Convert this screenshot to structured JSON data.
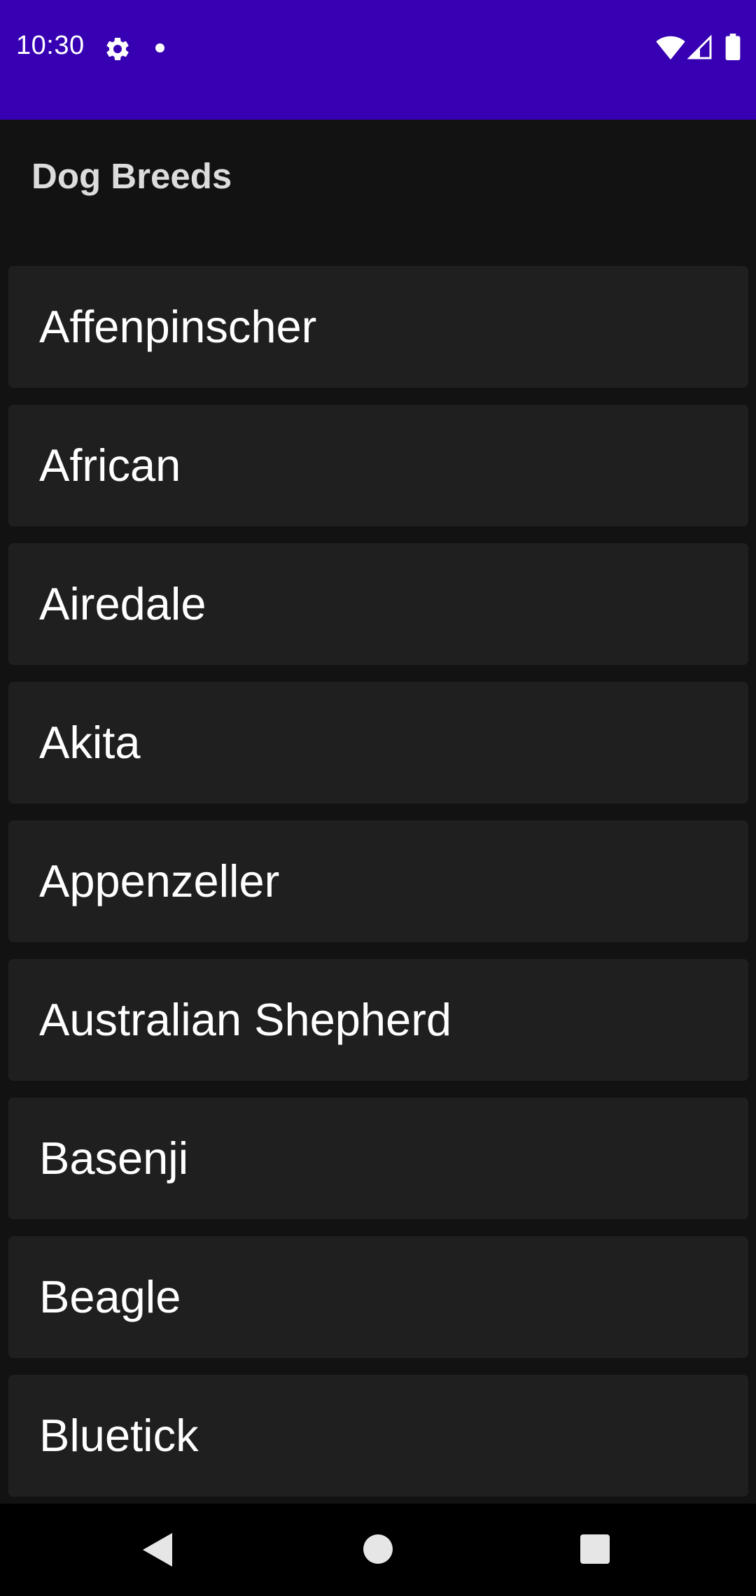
{
  "status_bar": {
    "time": "10:30",
    "icons": [
      "gear-icon",
      "notification-dot-icon",
      "wifi-icon",
      "signal-icon",
      "battery-icon"
    ],
    "background_color": "#3700b3"
  },
  "header": {
    "title": "Dog Breeds"
  },
  "breeds": [
    {
      "label": "Affenpinscher"
    },
    {
      "label": "African"
    },
    {
      "label": "Airedale"
    },
    {
      "label": "Akita"
    },
    {
      "label": "Appenzeller"
    },
    {
      "label": "Australian Shepherd"
    },
    {
      "label": "Basenji"
    },
    {
      "label": "Beagle"
    },
    {
      "label": "Bluetick"
    }
  ],
  "nav_bar": {
    "icons": [
      "back-icon",
      "home-icon",
      "recents-icon"
    ]
  }
}
